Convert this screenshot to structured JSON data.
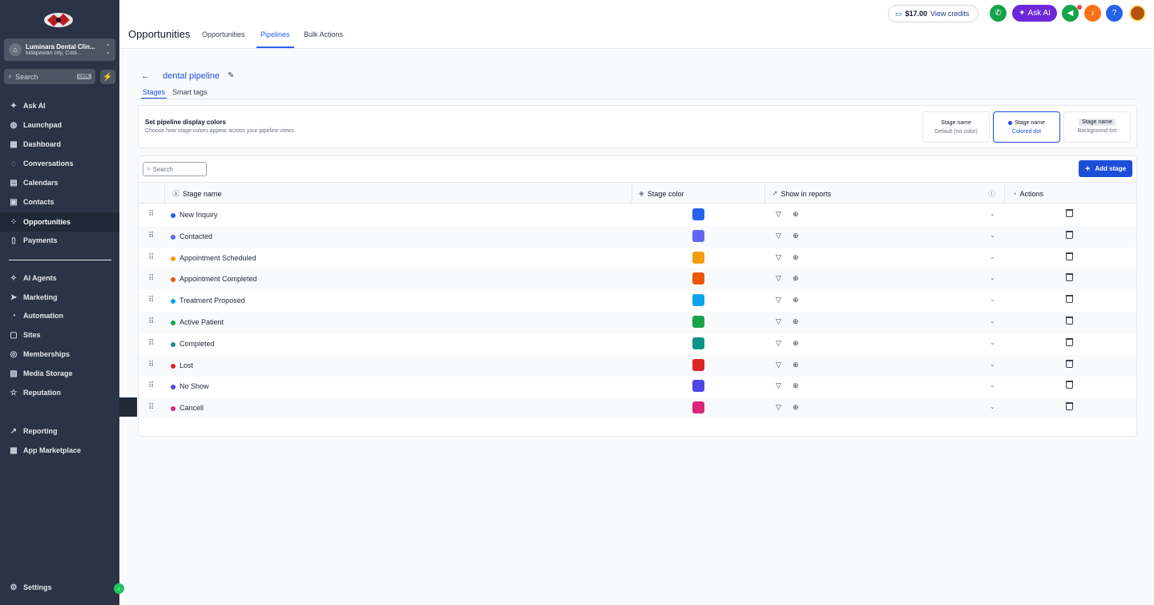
{
  "sidebar": {
    "account_name": "Luminara Dental Clin...",
    "account_location": "kidapawan city, Cota...",
    "search_placeholder": "Search",
    "search_shortcut": "ctrlK",
    "items": [
      {
        "label": "Ask AI",
        "icon": "sparkle-icon"
      },
      {
        "label": "Launchpad",
        "icon": "rocket-icon"
      },
      {
        "label": "Dashboard",
        "icon": "grid-icon"
      },
      {
        "label": "Conversations",
        "icon": "chat-icon"
      },
      {
        "label": "Calendars",
        "icon": "calendar-icon"
      },
      {
        "label": "Contacts",
        "icon": "contacts-icon"
      },
      {
        "label": "Opportunities",
        "icon": "opportunities-icon",
        "active": true
      },
      {
        "label": "Payments",
        "icon": "payments-icon"
      },
      {
        "label": "AI Agents",
        "icon": "ai-agents-icon"
      },
      {
        "label": "Marketing",
        "icon": "send-icon"
      },
      {
        "label": "Automation",
        "icon": "automation-icon"
      },
      {
        "label": "Sites",
        "icon": "sites-icon"
      },
      {
        "label": "Memberships",
        "icon": "membership-icon"
      },
      {
        "label": "Media Storage",
        "icon": "image-icon"
      },
      {
        "label": "Reputation",
        "icon": "star-icon"
      },
      {
        "label": "Reporting",
        "icon": "trend-icon"
      },
      {
        "label": "App Marketplace",
        "icon": "apps-icon"
      },
      {
        "label": "Settings",
        "icon": "gear-icon"
      }
    ]
  },
  "header": {
    "title": "Opportunities",
    "tabs": [
      {
        "label": "Opportunities",
        "active": false
      },
      {
        "label": "Pipelines",
        "active": true
      },
      {
        "label": "Bulk Actions",
        "active": false
      }
    ],
    "credits_amount": "$17.00",
    "credits_label": "View credits",
    "ask_ai_label": "Ask AI"
  },
  "pipeline": {
    "name": "dental pipeline",
    "subtabs": [
      {
        "label": "Stages",
        "active": true
      },
      {
        "label": "Smart tags",
        "active": false
      }
    ]
  },
  "display_colors": {
    "title": "Set pipeline display colors",
    "description": "Choose how stage colors appear across your pipeline views",
    "options": [
      {
        "name": "Stage name",
        "sub": "Default (no color)",
        "selected": false
      },
      {
        "name": "Stage name",
        "sub": "Colored dot",
        "selected": true
      },
      {
        "name": "Stage name",
        "sub": "Background tint",
        "selected": false
      }
    ]
  },
  "stages_table": {
    "search_placeholder": "Search",
    "add_button": "Add stage",
    "columns": [
      "Stage name",
      "Stage color",
      "Show in reports",
      "Actions"
    ],
    "rows": [
      {
        "name": "New Inquiry",
        "color": "#2563eb"
      },
      {
        "name": "Contacted",
        "color": "#6366f1"
      },
      {
        "name": "Appointment Scheduled",
        "color": "#f59e0b"
      },
      {
        "name": "Appointment Completed",
        "color": "#ea580c"
      },
      {
        "name": "Treatment Proposed",
        "color": "#0ea5e9"
      },
      {
        "name": "Active Patient",
        "color": "#16a34a"
      },
      {
        "name": "Completed",
        "color": "#0d9488"
      },
      {
        "name": "Lost",
        "color": "#dc2626"
      },
      {
        "name": "No Show",
        "color": "#4f46e5"
      },
      {
        "name": "Cancell",
        "color": "#db2777"
      }
    ]
  },
  "colors": {
    "sidebar_bg": "#2b3446",
    "accent": "#1d4ed8",
    "ask_ai": "#6d28d9"
  }
}
